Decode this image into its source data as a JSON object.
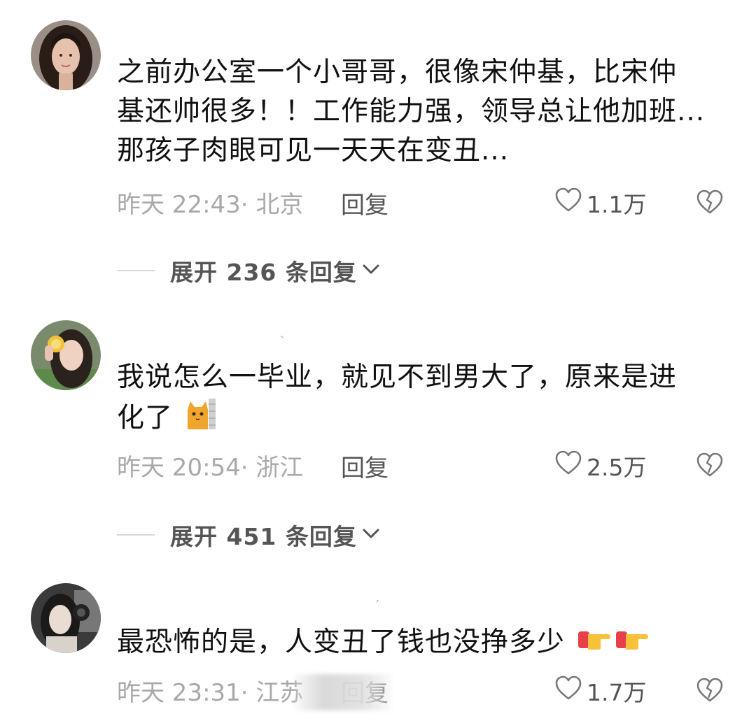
{
  "comments": [
    {
      "lines": [
        "之前办公室一个小哥哥，很像宋仲基，比宋仲",
        "基还帅很多！！工作能力强，领导总让他加班...",
        "那孩子肉眼可见一天天在变丑..."
      ],
      "meta": "昨天 22:43· 北京",
      "reply_label": "回复",
      "likes": "1.1万",
      "expand_label": "展开 236 条回复"
    },
    {
      "lines": [
        "我说怎么一毕业，就见不到男大了，原来是进",
        "化了"
      ],
      "meta": "昨天 20:54· 浙江",
      "reply_label": "回复",
      "likes": "2.5万",
      "expand_label": "展开 451 条回复"
    },
    {
      "lines": [
        "最恐怖的是，人变丑了钱也没挣多少"
      ],
      "meta": "昨天 23:31· 江苏",
      "reply_label": "回复",
      "likes": "1.7万"
    }
  ],
  "icons": {
    "like": "heart-outline-icon",
    "dislike": "broken-heart-icon",
    "expand": "chevron-down-icon",
    "emoji_2": "cat-peeking-emoji",
    "emoji_3": "pointing-right-hand-emoji"
  },
  "colors": {
    "text": "#111111",
    "meta": "#a9a9a9",
    "action": "#555555"
  }
}
